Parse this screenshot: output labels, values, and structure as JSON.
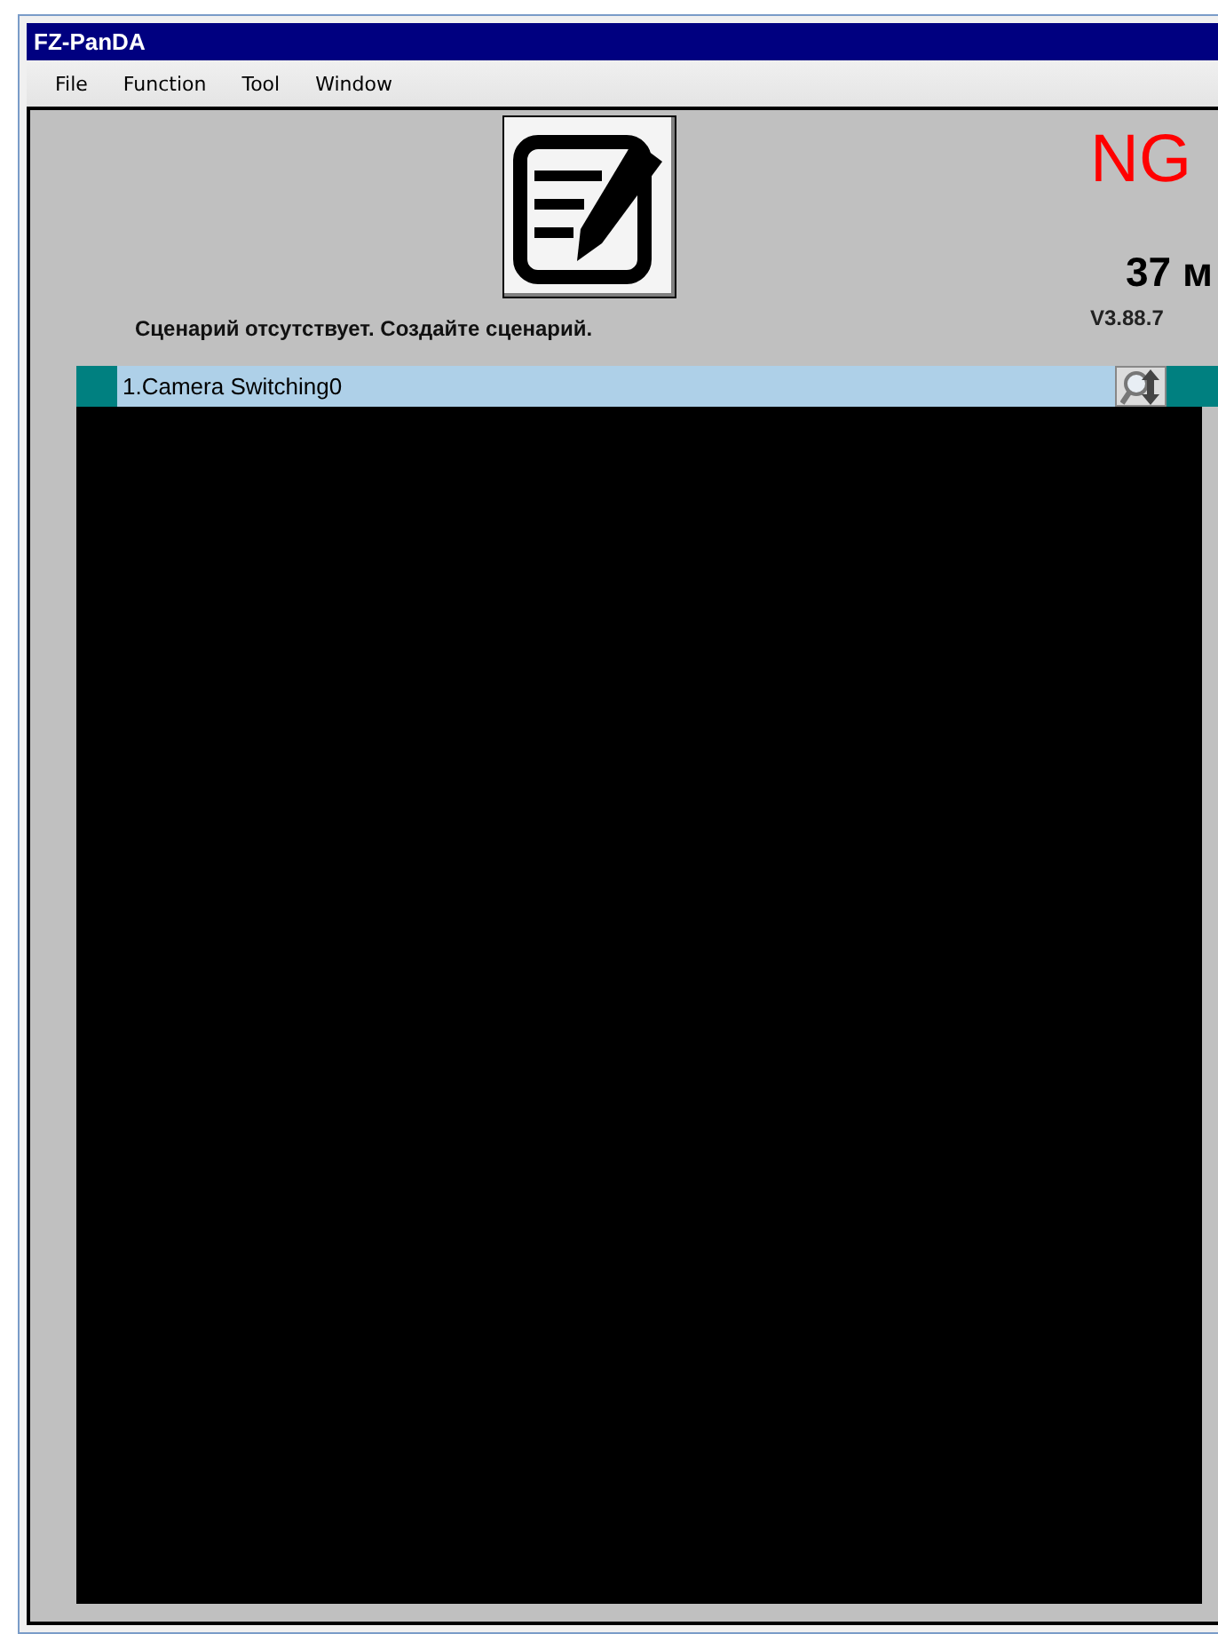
{
  "window": {
    "title": "FZ-PanDA"
  },
  "menu": [
    "File",
    "Function",
    "Tool",
    "Window"
  ],
  "status": {
    "result": "NG",
    "value": "37 м",
    "version": "V3.88.7"
  },
  "message": "Сценарий отсутствует. Создайте сценарий.",
  "scenarios": [
    {
      "label": "1.Camera Switching0",
      "selected": true
    }
  ]
}
